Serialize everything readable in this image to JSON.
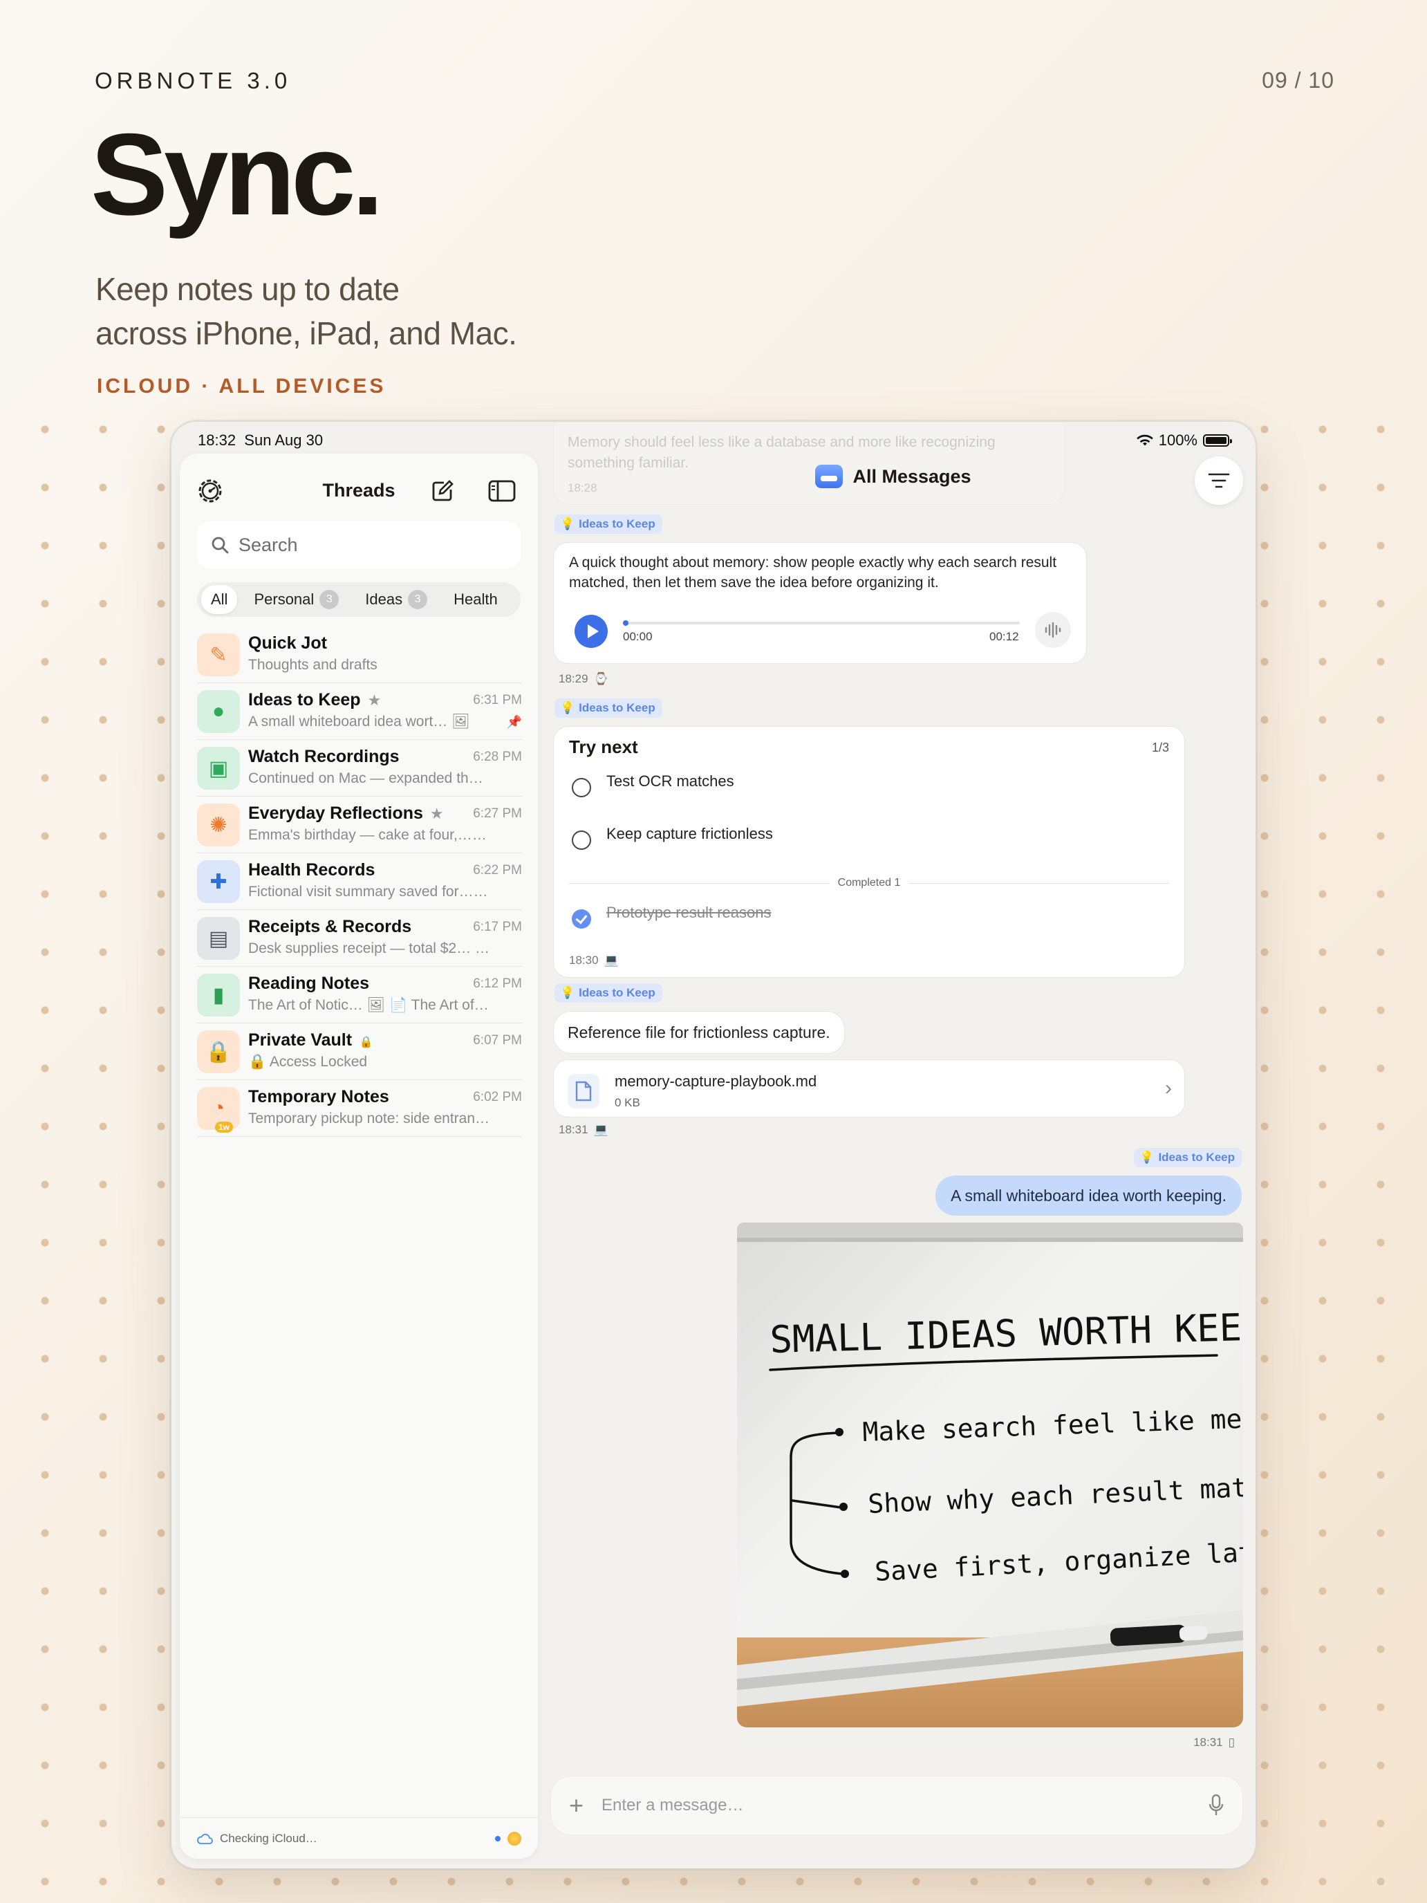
{
  "header": {
    "brand": "ORBNOTE 3.0",
    "pager": "09 / 10",
    "headline": "Sync.",
    "subtitle_line1": "Keep notes up to date",
    "subtitle_line2": "across iPhone, iPad, and Mac.",
    "tagline": "ICLOUD · ALL DEVICES"
  },
  "status_bar": {
    "time": "18:32",
    "date": "Sun Aug 30",
    "battery": "100%"
  },
  "sidebar": {
    "title": "Threads",
    "search_placeholder": "Search",
    "chips": [
      {
        "label": "All",
        "count": "",
        "active": true
      },
      {
        "label": "Personal",
        "count": "3",
        "active": false
      },
      {
        "label": "Ideas",
        "count": "3",
        "active": false
      },
      {
        "label": "Health",
        "count": "",
        "active": false
      }
    ],
    "threads": [
      {
        "name": "Quick Jot",
        "time": "",
        "preview": "Thoughts and drafts",
        "icon": "pencil-square-icon",
        "bg": "#fde5d2",
        "fg": "#ee8a3c",
        "starred": false,
        "locked": false,
        "pinned": false
      },
      {
        "name": "Ideas to Keep",
        "time": "6:31 PM",
        "preview": "A small whiteboard idea wort… 🖼",
        "icon": "lightbulb-icon",
        "bg": "#d6f1df",
        "fg": "#2faa5a",
        "starred": true,
        "locked": false,
        "pinned": true
      },
      {
        "name": "Watch Recordings",
        "time": "6:28 PM",
        "preview": "Continued on Mac — expanded the…",
        "icon": "watch-icon",
        "bg": "#d6f1df",
        "fg": "#2faa5a",
        "starred": false,
        "locked": false,
        "pinned": false
      },
      {
        "name": "Everyday Reflections",
        "time": "6:27 PM",
        "preview": "Emma's birthday — cake at four,… 🖼",
        "icon": "sun-icon",
        "bg": "#fde5d2",
        "fg": "#ef7a2a",
        "starred": true,
        "locked": false,
        "pinned": false
      },
      {
        "name": "Health Records",
        "time": "6:22 PM",
        "preview": "Fictional visit summary saved for… 🖼",
        "icon": "medical-case-icon",
        "bg": "#dbe6fb",
        "fg": "#2f6fdc",
        "starred": false,
        "locked": false,
        "pinned": false
      },
      {
        "name": "Receipts & Records",
        "time": "6:17 PM",
        "preview": "Desk supplies receipt — total $2… 🖼",
        "icon": "document-icon",
        "bg": "#e3e5e8",
        "fg": "#4d5560",
        "starred": false,
        "locked": false,
        "pinned": false
      },
      {
        "name": "Reading Notes",
        "time": "6:12 PM",
        "preview": "The Art of Notic… 🖼 📄 The Art of N…",
        "icon": "book-icon",
        "bg": "#d6f1df",
        "fg": "#2f9e55",
        "starred": false,
        "locked": false,
        "pinned": false
      },
      {
        "name": "Private Vault",
        "time": "6:07 PM",
        "preview": "🔒 Access Locked",
        "icon": "lock-icon",
        "bg": "#fde5d2",
        "fg": "#ee6a1c",
        "starred": false,
        "locked": true,
        "pinned": false
      },
      {
        "name": "Temporary Notes",
        "time": "6:02 PM",
        "preview": "Temporary pickup note: side entran…",
        "icon": "timer-icon",
        "bg": "#fde5d2",
        "fg": "#ee6a1c",
        "starred": false,
        "locked": false,
        "pinned": false,
        "badge": "1w"
      }
    ],
    "footer": "Checking iCloud…"
  },
  "main": {
    "title": "All Messages",
    "faded_text": "Memory should feel less like a database and more like recognizing something familiar.",
    "faded_time": "18:28",
    "tag_label": "Ideas to Keep",
    "audio": {
      "text": "A quick thought about memory: show people exactly why each search result matched, then let them save the idea before organizing it.",
      "start": "00:00",
      "end": "00:12",
      "progress": 0.0,
      "timestamp": "18:29"
    },
    "todo": {
      "title": "Try next",
      "count": "1/3",
      "items": [
        "Test OCR matches",
        "Keep capture frictionless"
      ],
      "completed_label": "Completed 1",
      "completed_items": [
        "Prototype result reasons"
      ],
      "timestamp": "18:30"
    },
    "file_message": {
      "text": "Reference file for frictionless capture.",
      "file_name": "memory-capture-playbook.md",
      "file_size": "0 KB",
      "timestamp": "18:31"
    },
    "outgoing": {
      "text": "A small whiteboard idea worth keeping.",
      "timestamp": "18:31"
    },
    "whiteboard": {
      "heading": "SMALL IDEAS WORTH KEEPING",
      "lines": [
        "Make search feel like memory",
        "Show why each result matched",
        "Save first, organize later"
      ]
    },
    "composer_placeholder": "Enter a message…"
  },
  "colors": {
    "accent": "#3d6fe8",
    "tagline": "#b45a27",
    "bubble_blue": "#c5dafb"
  }
}
